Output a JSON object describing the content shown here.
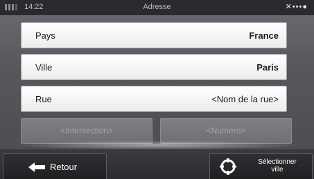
{
  "status_bar": {
    "time": "14:22",
    "title": "Adresse",
    "signal_icon": "satellite-signal-icon"
  },
  "fields": {
    "country": {
      "label": "Pays",
      "value": "France"
    },
    "city": {
      "label": "Ville",
      "value": "Paris"
    },
    "street": {
      "label": "Rue",
      "value": "<Nom de la rue>"
    },
    "intersection": {
      "placeholder": "<Intersection>"
    },
    "number": {
      "placeholder": "<Numéro>"
    }
  },
  "footer": {
    "back_label": "Retour",
    "back_icon": "arrow-left-icon",
    "select_city_label_line1": "Sélectionner",
    "select_city_label_line2": "ville",
    "select_city_icon": "crosshair-target-icon"
  },
  "colors": {
    "background": "#55575c",
    "status_bar": "#2a2b2e",
    "field_bg": "#ffffff",
    "disabled_field_bg": "#7d7f84",
    "button_bg": "#1f2022",
    "text_dark": "#1a1a1a",
    "text_light": "#ffffff"
  }
}
